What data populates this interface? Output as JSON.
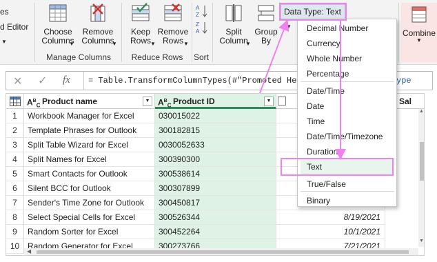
{
  "ribbon": {
    "left_partial": {
      "line1": "es",
      "line2": "d Editor"
    },
    "choose_columns": "Choose\nColumns",
    "remove_columns": "Remove\nColumns",
    "manage_columns_group": "Manage Columns",
    "keep_rows": "Keep\nRows",
    "remove_rows": "Remove\nRows",
    "reduce_rows_group": "Reduce Rows",
    "sort_group": "Sort",
    "split_column": "Split\nColumn",
    "group_by": "Group\nBy",
    "data_type_button": "Data Type: Text",
    "combine": "Combine"
  },
  "formula_bar": {
    "cancel": "✕",
    "confirm": "✓",
    "fx": "fx",
    "text": "= Table.TransformColumnTypes(#\"Promoted Hea",
    "tail": "ype"
  },
  "grid": {
    "columns": [
      {
        "type_icon": "ABC",
        "label": "Product name"
      },
      {
        "type_icon": "ABC",
        "label": "Product ID"
      },
      {
        "type_icon": "",
        "label": "Sal"
      }
    ],
    "rows": [
      {
        "n": "1",
        "name": "Workbook Manager for Excel",
        "id": "030015022",
        "date": ""
      },
      {
        "n": "2",
        "name": "Template Phrases for Outlook",
        "id": "300182815",
        "date": ""
      },
      {
        "n": "3",
        "name": "Split Table Wizard for Excel",
        "id": "0030052633",
        "date": ""
      },
      {
        "n": "4",
        "name": "Split Names for Excel",
        "id": "300390300",
        "date": ""
      },
      {
        "n": "5",
        "name": "Smart Contacts for Outlook",
        "id": "300538614",
        "date": ""
      },
      {
        "n": "6",
        "name": "Silent BCC for  Outlook",
        "id": "300307899",
        "date": ""
      },
      {
        "n": "7",
        "name": "Sender's Time Zone for Outlook",
        "id": "300450817",
        "date": ""
      },
      {
        "n": "8",
        "name": "Select Special Cells for Excel",
        "id": "300526344",
        "date": "8/19/2021"
      },
      {
        "n": "9",
        "name": "Random Sorter for Excel",
        "id": "300452264",
        "date": "10/1/2021"
      },
      {
        "n": "10",
        "name": "Random Generator for Excel",
        "id": "300273766",
        "date": "7/21/2021"
      }
    ]
  },
  "menu": {
    "items": [
      "Decimal Number",
      "Currency",
      "Whole Number",
      "Percentage",
      "Date/Time",
      "Date",
      "Time",
      "Date/Time/Timezone",
      "Duration",
      "Text",
      "True/False",
      "Binary"
    ],
    "highlighted": "Text"
  },
  "colors": {
    "highlight": "#ee82ee",
    "selected_column": "#dff2e6",
    "accent_green": "#2e8b57"
  }
}
